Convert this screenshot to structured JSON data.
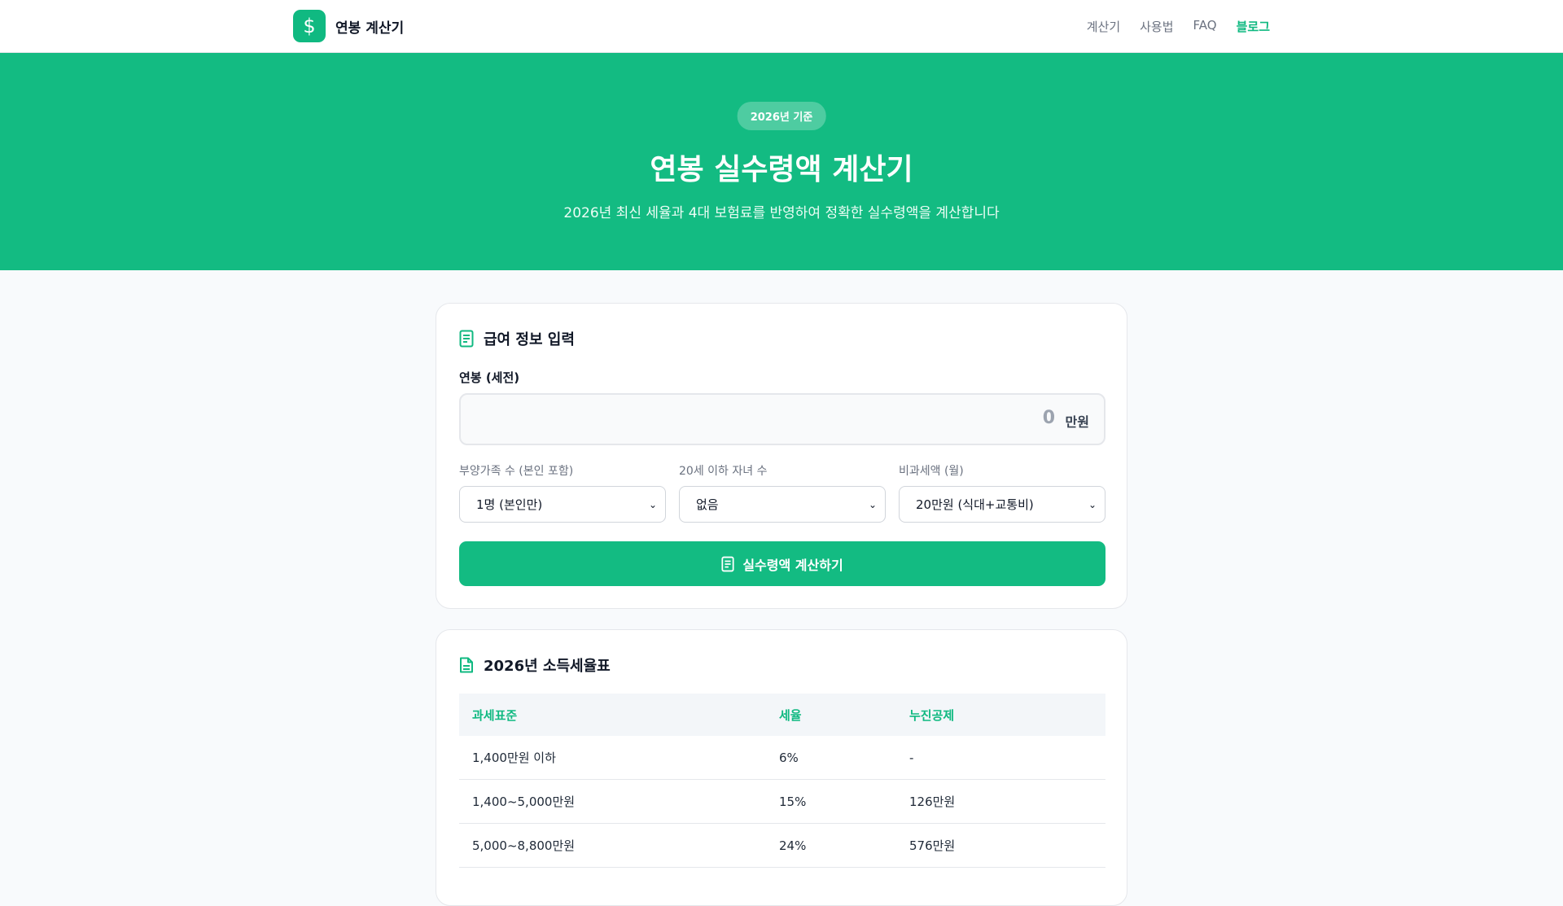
{
  "header": {
    "brand_name": "연봉 계산기",
    "logo_icon": "dollar-sign-icon",
    "nav": [
      {
        "label": "계산기"
      },
      {
        "label": "사용법"
      },
      {
        "label": "FAQ"
      },
      {
        "label": "블로그",
        "active": true
      }
    ]
  },
  "hero": {
    "badge": "2026년 기준",
    "title": "연봉 실수령액 계산기",
    "subtitle": "2026년 최신 세율과 4대 보험료를 반영하여 정확한 실수령액을 계산합니다"
  },
  "form": {
    "title": "급여 정보 입력",
    "salary_label": "연봉 (세전)",
    "salary_value": "0",
    "salary_unit": "만원",
    "dependents_label": "부양가족 수 (본인 포함)",
    "dependents_value": "1명 (본인만)",
    "children_label": "20세 이하 자녀 수",
    "children_value": "없음",
    "nontax_label": "비과세액 (월)",
    "nontax_value": "20만원 (식대+교통비)",
    "calc_button": "실수령액 계산하기"
  },
  "tax_table": {
    "title": "2026년 소득세율표",
    "headers": [
      "과세표준",
      "세율",
      "누진공제"
    ],
    "rows": [
      [
        "1,400만원 이하",
        "6%",
        "-"
      ],
      [
        "1,400~5,000만원",
        "15%",
        "126만원"
      ],
      [
        "5,000~8,800만원",
        "24%",
        "576만원"
      ]
    ]
  },
  "colors": {
    "accent": "#10b981",
    "hero_bg": "#13bb82"
  }
}
